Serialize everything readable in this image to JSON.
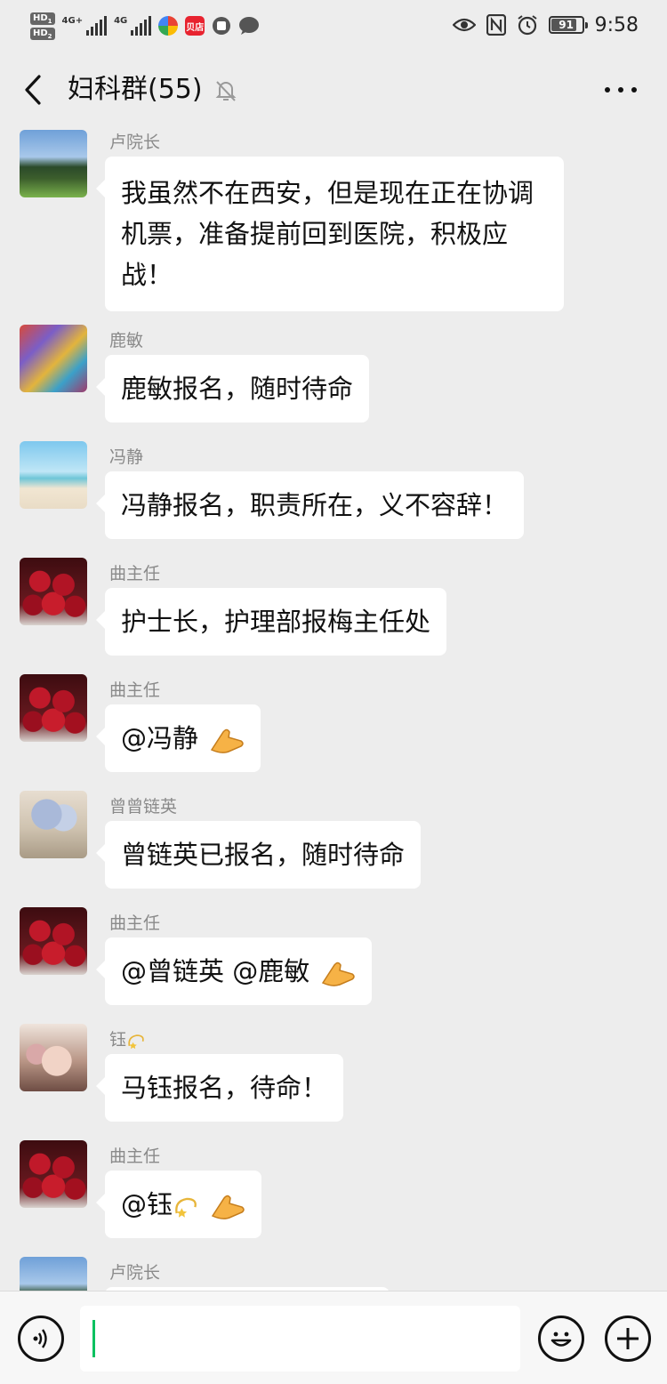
{
  "status_bar": {
    "hd1": "HD",
    "hd1_sub": "1",
    "hd2": "HD",
    "hd2_sub": "2",
    "net1": "4G+",
    "net2": "4G",
    "app_badge": "贝店",
    "battery": "91",
    "time": "9:58",
    "icons": [
      "eye-icon",
      "nfc-icon",
      "alarm-icon"
    ]
  },
  "header": {
    "title": "妇科群(55)",
    "muted_icon": "bell-off-icon",
    "more_icon": "more-dots-icon"
  },
  "messages": [
    {
      "sender": "卢院长",
      "avatar": "forest",
      "text": "我虽然不在西安，但是现在正在协调机票，准备提前回到医院，积极应战！"
    },
    {
      "sender": "鹿敏",
      "avatar": "cartoon",
      "text": "鹿敏报名，随时待命"
    },
    {
      "sender": "冯静",
      "avatar": "beach",
      "text": "冯静报名，职责所在，义不容辞！"
    },
    {
      "sender": "曲主任",
      "avatar": "flowers",
      "text": "护士长，护理部报梅主任处"
    },
    {
      "sender": "曲主任",
      "avatar": "flowers",
      "text": "@冯静",
      "emoji": "pointing-hand-emoji"
    },
    {
      "sender": "曾曾链英",
      "avatar": "hydrangea",
      "text": "曾链英已报名，随时待命"
    },
    {
      "sender": "曲主任",
      "avatar": "flowers",
      "text": "@曾链英 @鹿敏",
      "emoji": "pointing-hand-emoji"
    },
    {
      "sender": "钰",
      "sender_emoji": "dizzy-star-emoji",
      "avatar": "girl",
      "text": "马钰报名，待命！"
    },
    {
      "sender": "曲主任",
      "avatar": "flowers",
      "text": "@钰",
      "inline_emoji": "dizzy-star-emoji",
      "emoji": "pointing-hand-emoji"
    },
    {
      "sender": "卢院长",
      "avatar": "forest",
      "text": ""
    }
  ],
  "input_bar": {
    "voice_icon": "voice-icon",
    "input_value": "",
    "emoji_icon": "smiley-icon",
    "plus_icon": "plus-icon"
  },
  "colors": {
    "background": "#ededed",
    "bubble": "#ffffff",
    "caret": "#07c160",
    "sender_name": "#8a8a8a"
  }
}
